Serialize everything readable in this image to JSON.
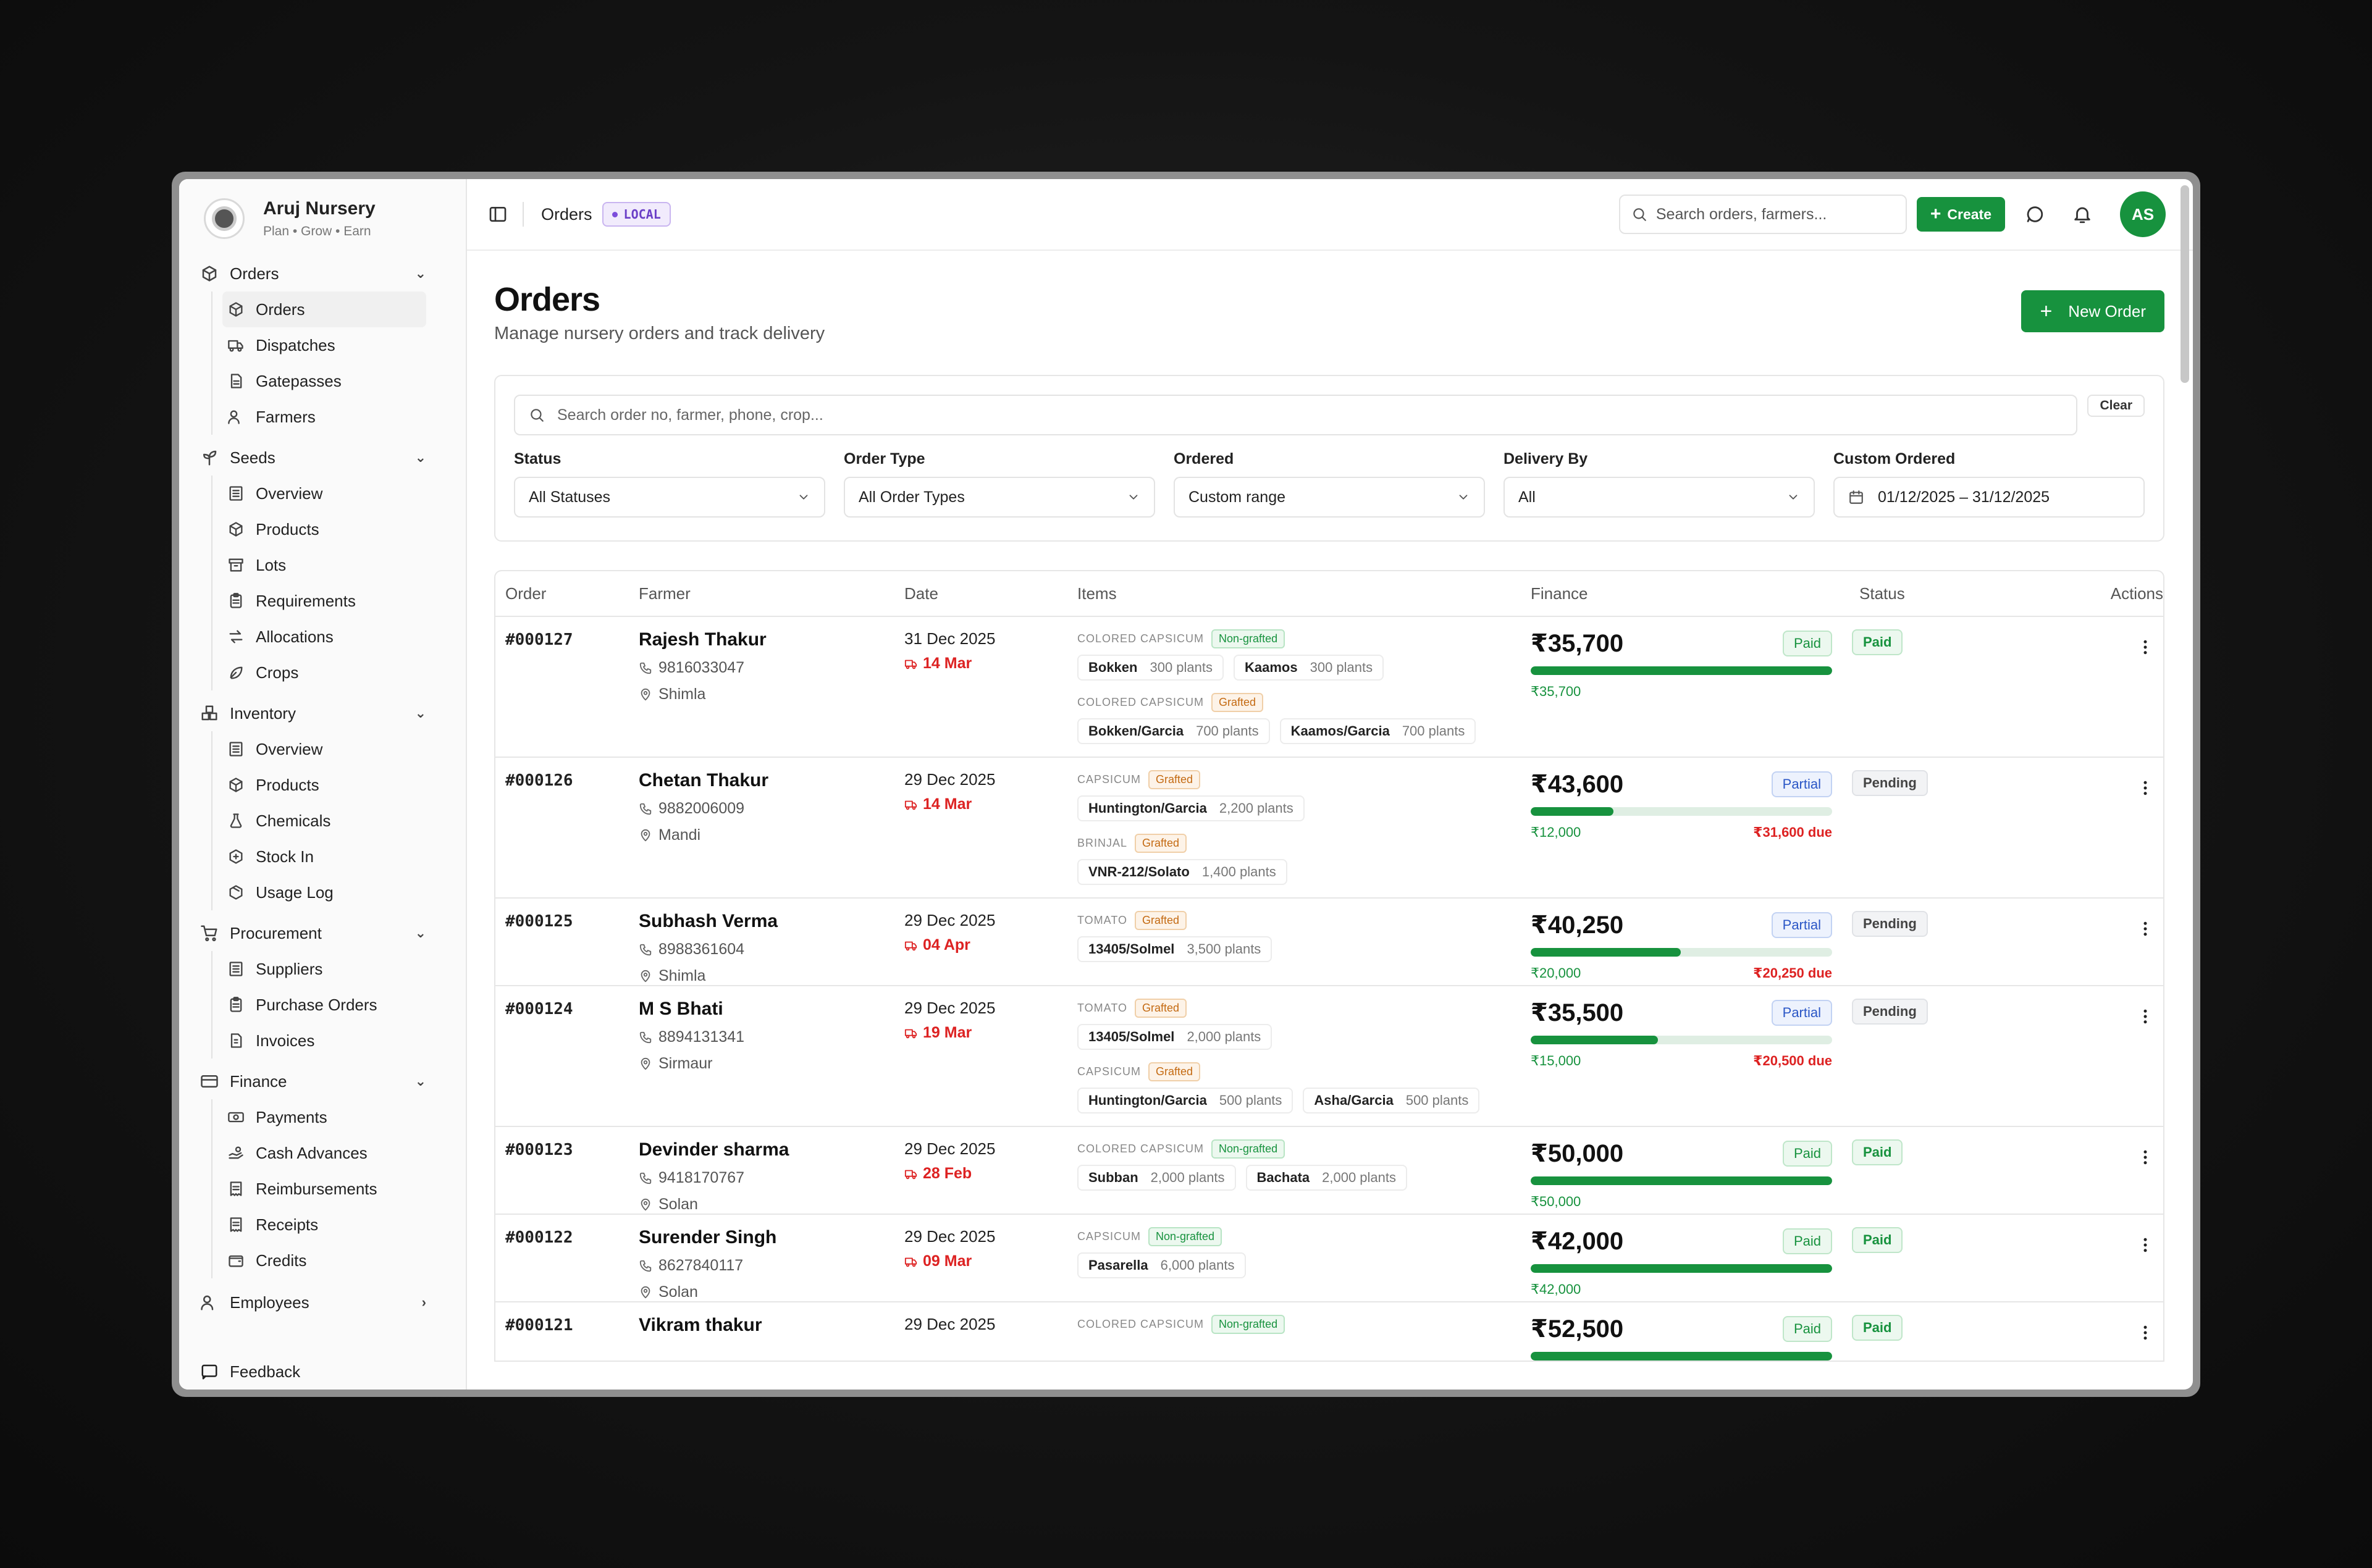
{
  "brand": {
    "name": "Aruj Nursery",
    "tagline": "Plan • Grow • Earn"
  },
  "sidebar": {
    "groups": [
      {
        "label": "Orders",
        "icon": "box-icon",
        "items": [
          {
            "label": "Orders",
            "icon": "box-icon",
            "active": true
          },
          {
            "label": "Dispatches",
            "icon": "truck-icon"
          },
          {
            "label": "Gatepasses",
            "icon": "document-icon"
          },
          {
            "label": "Farmers",
            "icon": "users-icon"
          }
        ]
      },
      {
        "label": "Seeds",
        "icon": "sprout-icon",
        "items": [
          {
            "label": "Overview",
            "icon": "building-icon"
          },
          {
            "label": "Products",
            "icon": "box-icon"
          },
          {
            "label": "Lots",
            "icon": "archive-icon"
          },
          {
            "label": "Requirements",
            "icon": "clipboard-icon"
          },
          {
            "label": "Allocations",
            "icon": "arrows-icon"
          },
          {
            "label": "Crops",
            "icon": "leaf-icon"
          }
        ]
      },
      {
        "label": "Inventory",
        "icon": "boxes-icon",
        "items": [
          {
            "label": "Overview",
            "icon": "building-icon"
          },
          {
            "label": "Products",
            "icon": "box-icon"
          },
          {
            "label": "Chemicals",
            "icon": "flask-icon"
          },
          {
            "label": "Stock In",
            "icon": "package-plus-icon"
          },
          {
            "label": "Usage Log",
            "icon": "package-icon"
          }
        ]
      },
      {
        "label": "Procurement",
        "icon": "cart-icon",
        "items": [
          {
            "label": "Suppliers",
            "icon": "building-icon"
          },
          {
            "label": "Purchase Orders",
            "icon": "clipboard-icon"
          },
          {
            "label": "Invoices",
            "icon": "invoice-icon"
          }
        ]
      },
      {
        "label": "Finance",
        "icon": "card-icon",
        "items": [
          {
            "label": "Payments",
            "icon": "banknote-icon"
          },
          {
            "label": "Cash Advances",
            "icon": "hand-coins-icon"
          },
          {
            "label": "Reimbursements",
            "icon": "receipt-icon"
          },
          {
            "label": "Receipts",
            "icon": "receipt-icon"
          },
          {
            "label": "Credits",
            "icon": "wallet-icon"
          }
        ]
      }
    ],
    "employees": "Employees",
    "feedback": "Feedback"
  },
  "topbar": {
    "breadcrumb": "Orders",
    "env_badge": "LOCAL",
    "search_placeholder": "Search orders, farmers...",
    "create_label": "Create",
    "avatar_initials": "AS"
  },
  "page": {
    "title": "Orders",
    "subtitle": "Manage nursery orders and track delivery",
    "new_order_label": "New Order"
  },
  "filters": {
    "search_placeholder": "Search order no, farmer, phone, crop...",
    "clear_label": "Clear",
    "status": {
      "label": "Status",
      "value": "All Statuses"
    },
    "order_type": {
      "label": "Order Type",
      "value": "All Order Types"
    },
    "ordered": {
      "label": "Ordered",
      "value": "Custom range"
    },
    "delivery_by": {
      "label": "Delivery By",
      "value": "All"
    },
    "custom_ordered": {
      "label": "Custom Ordered",
      "value": "01/12/2025 – 31/12/2025"
    }
  },
  "table": {
    "headers": {
      "order": "Order",
      "farmer": "Farmer",
      "date": "Date",
      "items": "Items",
      "finance": "Finance",
      "status": "Status",
      "actions": "Actions"
    },
    "rows": [
      {
        "id": "#000127",
        "farmer": "Rajesh Thakur",
        "phone": "9816033047",
        "location": "Shimla",
        "date": "31 Dec 2025",
        "due": "14 Mar",
        "items": [
          {
            "crop": "COLORED CAPSICUM",
            "tag": "Non-grafted",
            "tag_type": "ng",
            "varieties": [
              {
                "name": "Bokken",
                "qty": "300 plants"
              },
              {
                "name": "Kaamos",
                "qty": "300 plants"
              }
            ]
          },
          {
            "crop": "COLORED CAPSICUM",
            "tag": "Grafted",
            "tag_type": "g",
            "varieties": [
              {
                "name": "Bokken/Garcia",
                "qty": "700 plants"
              },
              {
                "name": "Kaamos/Garcia",
                "qty": "700 plants"
              }
            ]
          }
        ],
        "amount": "₹35,700",
        "pay_badge": "Paid",
        "pay_type": "paid",
        "progress": 1.0,
        "paid": "₹35,700",
        "due_amt": "",
        "status": "Paid",
        "status_type": "paid"
      },
      {
        "id": "#000126",
        "farmer": "Chetan Thakur",
        "phone": "9882006009",
        "location": "Mandi",
        "date": "29 Dec 2025",
        "due": "14 Mar",
        "items": [
          {
            "crop": "CAPSICUM",
            "tag": "Grafted",
            "tag_type": "g",
            "varieties": [
              {
                "name": "Huntington/Garcia",
                "qty": "2,200 plants"
              }
            ]
          },
          {
            "crop": "BRINJAL",
            "tag": "Grafted",
            "tag_type": "g",
            "varieties": [
              {
                "name": "VNR-212/Solato",
                "qty": "1,400 plants"
              }
            ]
          }
        ],
        "amount": "₹43,600",
        "pay_badge": "Partial",
        "pay_type": "partial",
        "progress": 0.275,
        "paid": "₹12,000",
        "due_amt": "₹31,600 due",
        "status": "Pending",
        "status_type": "pending"
      },
      {
        "id": "#000125",
        "farmer": "Subhash Verma",
        "phone": "8988361604",
        "location": "Shimla",
        "date": "29 Dec 2025",
        "due": "04 Apr",
        "items": [
          {
            "crop": "TOMATO",
            "tag": "Grafted",
            "tag_type": "g",
            "varieties": [
              {
                "name": "13405/Solmel",
                "qty": "3,500 plants"
              }
            ]
          }
        ],
        "amount": "₹40,250",
        "pay_badge": "Partial",
        "pay_type": "partial",
        "progress": 0.497,
        "paid": "₹20,000",
        "due_amt": "₹20,250 due",
        "status": "Pending",
        "status_type": "pending"
      },
      {
        "id": "#000124",
        "farmer": "M S Bhati",
        "phone": "8894131341",
        "location": "Sirmaur",
        "date": "29 Dec 2025",
        "due": "19 Mar",
        "items": [
          {
            "crop": "TOMATO",
            "tag": "Grafted",
            "tag_type": "g",
            "varieties": [
              {
                "name": "13405/Solmel",
                "qty": "2,000 plants"
              }
            ]
          },
          {
            "crop": "CAPSICUM",
            "tag": "Grafted",
            "tag_type": "g",
            "varieties": [
              {
                "name": "Huntington/Garcia",
                "qty": "500 plants"
              },
              {
                "name": "Asha/Garcia",
                "qty": "500 plants"
              }
            ]
          }
        ],
        "amount": "₹35,500",
        "pay_badge": "Partial",
        "pay_type": "partial",
        "progress": 0.423,
        "paid": "₹15,000",
        "due_amt": "₹20,500 due",
        "status": "Pending",
        "status_type": "pending"
      },
      {
        "id": "#000123",
        "farmer": "Devinder sharma",
        "phone": "9418170767",
        "location": "Solan",
        "date": "29 Dec 2025",
        "due": "28 Feb",
        "items": [
          {
            "crop": "COLORED CAPSICUM",
            "tag": "Non-grafted",
            "tag_type": "ng",
            "varieties": [
              {
                "name": "Subban",
                "qty": "2,000 plants"
              },
              {
                "name": "Bachata",
                "qty": "2,000 plants"
              }
            ]
          }
        ],
        "amount": "₹50,000",
        "pay_badge": "Paid",
        "pay_type": "paid",
        "progress": 1.0,
        "paid": "₹50,000",
        "due_amt": "",
        "status": "Paid",
        "status_type": "paid"
      },
      {
        "id": "#000122",
        "farmer": "Surender Singh",
        "phone": "8627840117",
        "location": "Solan",
        "date": "29 Dec 2025",
        "due": "09 Mar",
        "items": [
          {
            "crop": "CAPSICUM",
            "tag": "Non-grafted",
            "tag_type": "ng",
            "varieties": [
              {
                "name": "Pasarella",
                "qty": "6,000 plants"
              }
            ]
          }
        ],
        "amount": "₹42,000",
        "pay_badge": "Paid",
        "pay_type": "paid",
        "progress": 1.0,
        "paid": "₹42,000",
        "due_amt": "",
        "status": "Paid",
        "status_type": "paid"
      },
      {
        "id": "#000121",
        "farmer": "Vikram thakur",
        "phone": "",
        "location": "",
        "date": "29 Dec 2025",
        "due": "",
        "items": [
          {
            "crop": "COLORED CAPSICUM",
            "tag": "Non-grafted",
            "tag_type": "ng",
            "varieties": []
          }
        ],
        "amount": "₹52,500",
        "pay_badge": "Paid",
        "pay_type": "paid",
        "progress": 1.0,
        "paid": "",
        "due_amt": "",
        "status": "Paid",
        "status_type": "paid"
      }
    ]
  },
  "colors": {
    "accent": "#17923e",
    "danger": "#dd2222",
    "partial": "#2a56c6",
    "local_badge": "#6b3fc7"
  }
}
